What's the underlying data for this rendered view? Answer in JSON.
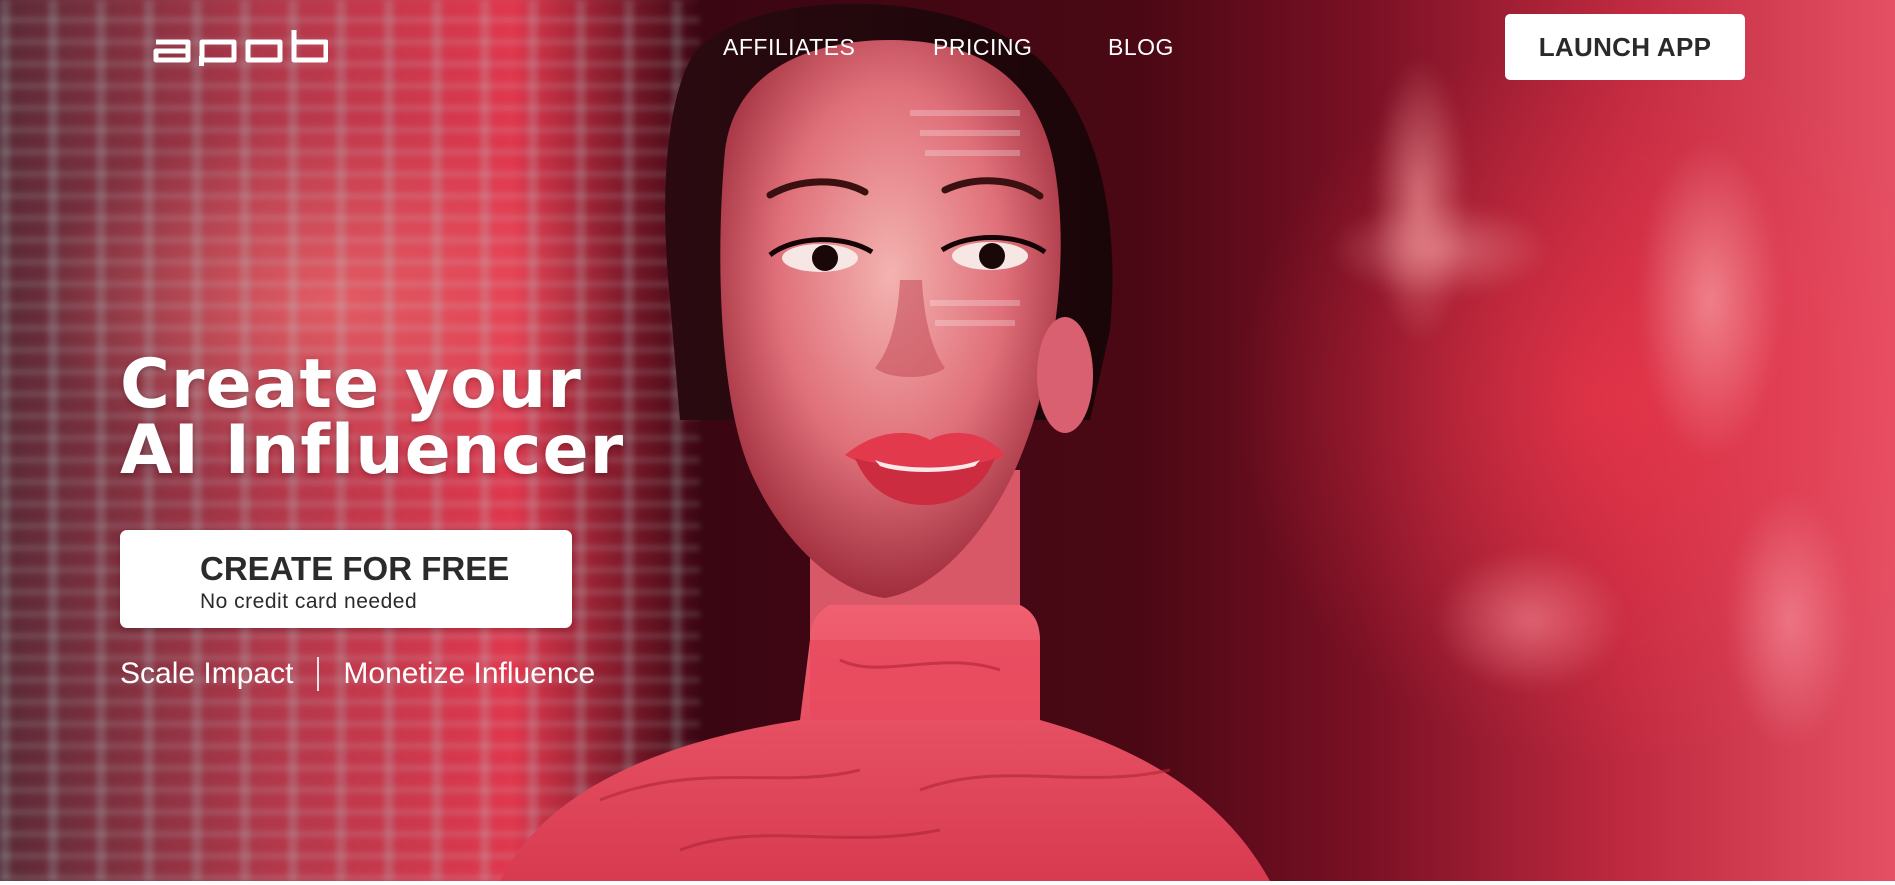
{
  "brand": {
    "logo_text": "apob"
  },
  "nav": {
    "links": [
      {
        "label": "AFFILIATES"
      },
      {
        "label": "PRICING"
      },
      {
        "label": "BLOG"
      }
    ],
    "launch_label": "LAUNCH APP"
  },
  "hero": {
    "headline_line1": "Create your",
    "headline_line2": "AI Influencer",
    "cta_title": "CREATE FOR FREE",
    "cta_subtitle": "No credit card needed",
    "tagline_left": "Scale Impact",
    "tagline_right": "Monetize Influence"
  },
  "colors": {
    "accent_red": "#e0384e",
    "button_bg": "#ffffff",
    "button_text": "#2b2b2b",
    "text_light": "#ffffff"
  },
  "icons": {
    "logo": "apob-wordmark"
  }
}
